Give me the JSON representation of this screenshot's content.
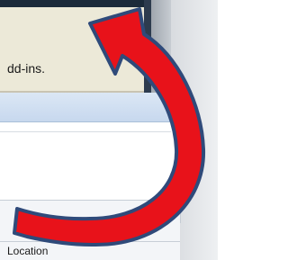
{
  "dialog": {
    "body_text": "dd-ins.",
    "column_header": "Location"
  },
  "overlay": {
    "arrow_icon": "curved-arrow-icon",
    "arrow_fill": "#e8121a",
    "arrow_stroke": "#2f4a7a"
  }
}
